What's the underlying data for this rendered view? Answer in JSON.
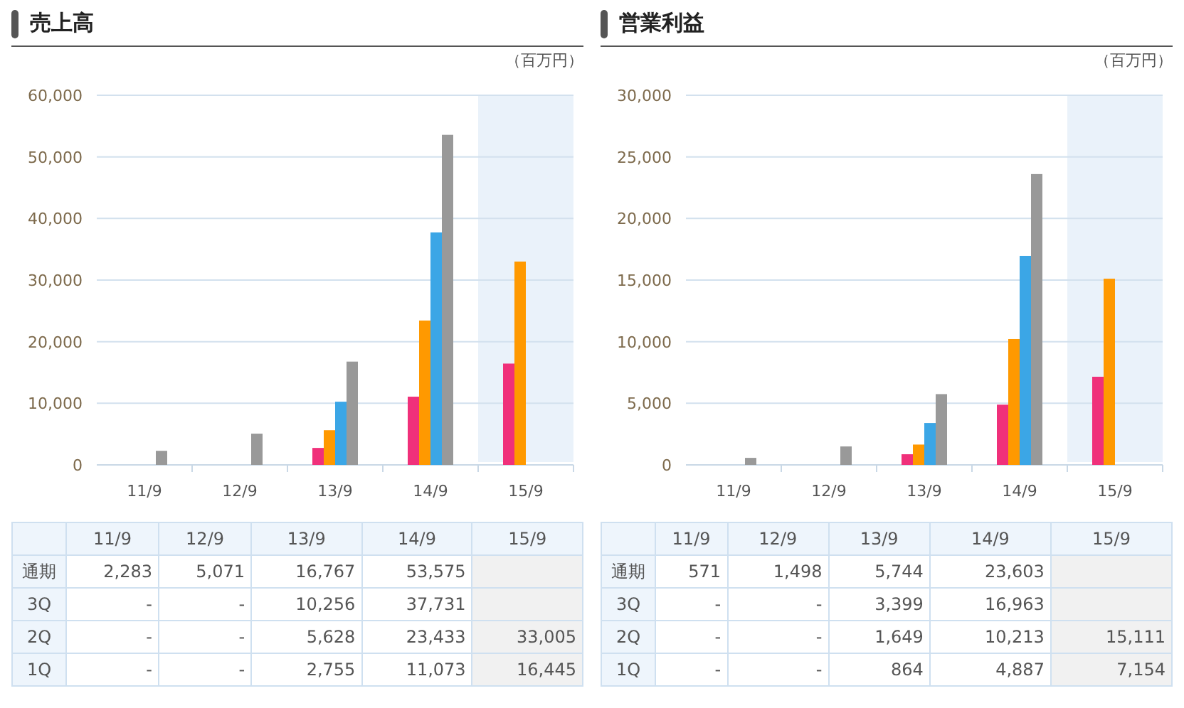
{
  "panels": [
    {
      "title": "売上高",
      "unit": "（百万円）",
      "chart_data": {
        "type": "bar",
        "categories": [
          "11/9",
          "12/9",
          "13/9",
          "14/9",
          "15/9"
        ],
        "grid": true,
        "ylim": [
          0,
          60000
        ],
        "yticks": [
          {
            "value": 0,
            "label": "0"
          },
          {
            "value": 10000,
            "label": "10,000"
          },
          {
            "value": 20000,
            "label": "20,000"
          },
          {
            "value": 30000,
            "label": "30,000"
          },
          {
            "value": 40000,
            "label": "40,000"
          },
          {
            "value": 50000,
            "label": "50,000"
          },
          {
            "value": 60000,
            "label": "60,000"
          }
        ],
        "series": [
          {
            "color": "#f0307a",
            "values": [
              null,
              null,
              2755,
              11073,
              16445
            ]
          },
          {
            "color": "#ff9900",
            "values": [
              null,
              null,
              5628,
              23433,
              33005
            ]
          },
          {
            "color": "#3ba6e6",
            "values": [
              null,
              null,
              10256,
              37731,
              null
            ]
          },
          {
            "color": "#999999",
            "values": [
              2283,
              5071,
              16767,
              53575,
              null
            ]
          }
        ]
      },
      "table": {
        "columns": [
          {
            "label": "11/9",
            "highlighted": false
          },
          {
            "label": "12/9",
            "highlighted": false
          },
          {
            "label": "13/9",
            "highlighted": false
          },
          {
            "label": "14/9",
            "highlighted": false
          },
          {
            "label": "15/9",
            "highlighted": true
          }
        ],
        "rows": [
          {
            "label": "通期",
            "cells": [
              "2,283",
              "5,071",
              "16,767",
              "53,575",
              null
            ]
          },
          {
            "label": "3Q",
            "cells": [
              "-",
              "-",
              "10,256",
              "37,731",
              null
            ]
          },
          {
            "label": "2Q",
            "cells": [
              "-",
              "-",
              "5,628",
              "23,433",
              "33,005"
            ]
          },
          {
            "label": "1Q",
            "cells": [
              "-",
              "-",
              "2,755",
              "11,073",
              "16,445"
            ]
          }
        ]
      }
    },
    {
      "title": "営業利益",
      "unit": "（百万円）",
      "chart_data": {
        "type": "bar",
        "categories": [
          "11/9",
          "12/9",
          "13/9",
          "14/9",
          "15/9"
        ],
        "grid": true,
        "ylim": [
          0,
          30000
        ],
        "yticks": [
          {
            "value": 0,
            "label": "0"
          },
          {
            "value": 5000,
            "label": "5,000"
          },
          {
            "value": 10000,
            "label": "10,000"
          },
          {
            "value": 15000,
            "label": "15,000"
          },
          {
            "value": 20000,
            "label": "20,000"
          },
          {
            "value": 25000,
            "label": "25,000"
          },
          {
            "value": 30000,
            "label": "30,000"
          }
        ],
        "series": [
          {
            "color": "#f0307a",
            "values": [
              null,
              null,
              864,
              4887,
              7154
            ]
          },
          {
            "color": "#ff9900",
            "values": [
              null,
              null,
              1649,
              10213,
              15111
            ]
          },
          {
            "color": "#3ba6e6",
            "values": [
              null,
              null,
              3399,
              16963,
              null
            ]
          },
          {
            "color": "#999999",
            "values": [
              571,
              1498,
              5744,
              23603,
              null
            ]
          }
        ]
      },
      "table": {
        "columns": [
          {
            "label": "11/9",
            "highlighted": false
          },
          {
            "label": "12/9",
            "highlighted": false
          },
          {
            "label": "13/9",
            "highlighted": false
          },
          {
            "label": "14/9",
            "highlighted": false
          },
          {
            "label": "15/9",
            "highlighted": true
          }
        ],
        "rows": [
          {
            "label": "通期",
            "cells": [
              "571",
              "1,498",
              "5,744",
              "23,603",
              null
            ]
          },
          {
            "label": "3Q",
            "cells": [
              "-",
              "-",
              "3,399",
              "16,963",
              null
            ]
          },
          {
            "label": "2Q",
            "cells": [
              "-",
              "-",
              "1,649",
              "10,213",
              "15,111"
            ]
          },
          {
            "label": "1Q",
            "cells": [
              "-",
              "-",
              "864",
              "4,887",
              "7,154"
            ]
          }
        ]
      }
    }
  ]
}
